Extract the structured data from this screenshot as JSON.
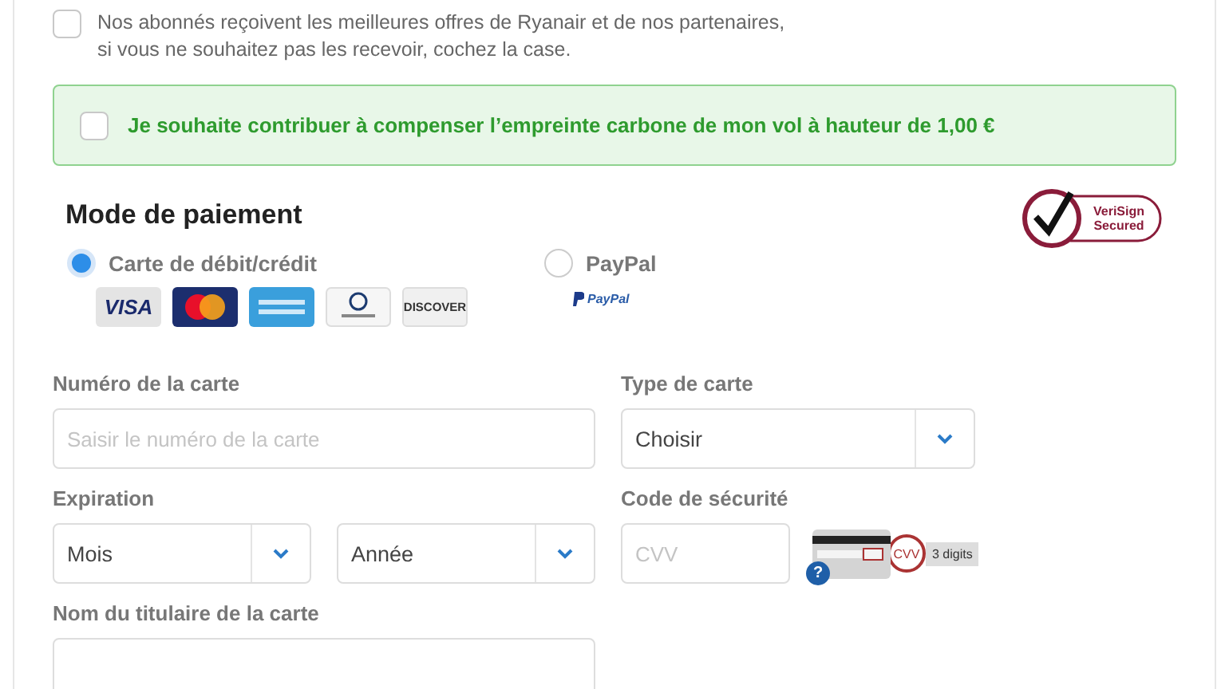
{
  "newsletter": {
    "checked": false,
    "text": "Nos abonnés reçoivent les meilleures offres de Ryanair et de nos partenaires,\nsi vous ne souhaitez pas les recevoir, cochez la case."
  },
  "carbon": {
    "checked": false,
    "text": "Je souhaite contribuer à compenser l’empreinte carbone de mon vol à hauteur de 1,00 €"
  },
  "payment": {
    "title": "Mode de paiement",
    "badge": {
      "line1": "VeriSign",
      "line2": "Secured"
    },
    "methods": [
      {
        "label": "Carte de débit/crédit",
        "selected": true,
        "logos": [
          {
            "kind": "visa",
            "text": "VISA"
          },
          {
            "kind": "mastercard"
          },
          {
            "kind": "amex"
          },
          {
            "kind": "diners"
          },
          {
            "kind": "discover",
            "text": "DISCOVER"
          }
        ]
      },
      {
        "label": "PayPal",
        "selected": false,
        "logos": [
          {
            "kind": "paypal",
            "text": "PayPal"
          }
        ]
      }
    ]
  },
  "fields": [
    {
      "kind": "input",
      "label": "Numéro de la carte",
      "placeholder": "Saisir le numéro de la carte"
    },
    {
      "kind": "select",
      "label": "Type de carte",
      "value": "Choisir"
    },
    {
      "kind": "pair",
      "label": "Expiration",
      "values": [
        "Mois",
        "Année"
      ]
    },
    {
      "kind": "cvv",
      "label": "Code de sécurité",
      "placeholder": "CVV",
      "hint": {
        "help": "?",
        "tag": "CVV",
        "digits": "3 digits"
      }
    },
    {
      "kind": "input",
      "label": "Nom du titulaire de la carte"
    }
  ]
}
